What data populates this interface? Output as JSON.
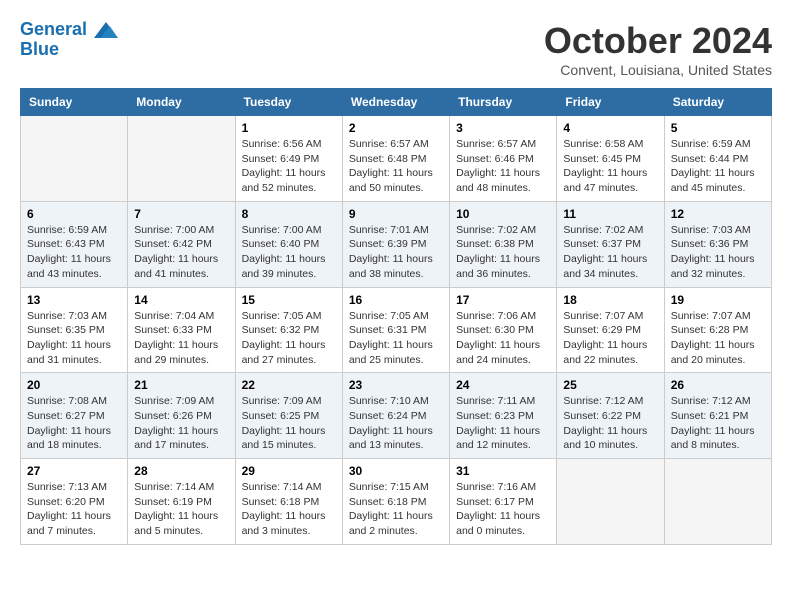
{
  "logo": {
    "line1": "General",
    "line2": "Blue"
  },
  "title": "October 2024",
  "location": "Convent, Louisiana, United States",
  "days_of_week": [
    "Sunday",
    "Monday",
    "Tuesday",
    "Wednesday",
    "Thursday",
    "Friday",
    "Saturday"
  ],
  "weeks": [
    [
      {
        "day": "",
        "info": ""
      },
      {
        "day": "",
        "info": ""
      },
      {
        "day": "1",
        "info": "Sunrise: 6:56 AM\nSunset: 6:49 PM\nDaylight: 11 hours and 52 minutes."
      },
      {
        "day": "2",
        "info": "Sunrise: 6:57 AM\nSunset: 6:48 PM\nDaylight: 11 hours and 50 minutes."
      },
      {
        "day": "3",
        "info": "Sunrise: 6:57 AM\nSunset: 6:46 PM\nDaylight: 11 hours and 48 minutes."
      },
      {
        "day": "4",
        "info": "Sunrise: 6:58 AM\nSunset: 6:45 PM\nDaylight: 11 hours and 47 minutes."
      },
      {
        "day": "5",
        "info": "Sunrise: 6:59 AM\nSunset: 6:44 PM\nDaylight: 11 hours and 45 minutes."
      }
    ],
    [
      {
        "day": "6",
        "info": "Sunrise: 6:59 AM\nSunset: 6:43 PM\nDaylight: 11 hours and 43 minutes."
      },
      {
        "day": "7",
        "info": "Sunrise: 7:00 AM\nSunset: 6:42 PM\nDaylight: 11 hours and 41 minutes."
      },
      {
        "day": "8",
        "info": "Sunrise: 7:00 AM\nSunset: 6:40 PM\nDaylight: 11 hours and 39 minutes."
      },
      {
        "day": "9",
        "info": "Sunrise: 7:01 AM\nSunset: 6:39 PM\nDaylight: 11 hours and 38 minutes."
      },
      {
        "day": "10",
        "info": "Sunrise: 7:02 AM\nSunset: 6:38 PM\nDaylight: 11 hours and 36 minutes."
      },
      {
        "day": "11",
        "info": "Sunrise: 7:02 AM\nSunset: 6:37 PM\nDaylight: 11 hours and 34 minutes."
      },
      {
        "day": "12",
        "info": "Sunrise: 7:03 AM\nSunset: 6:36 PM\nDaylight: 11 hours and 32 minutes."
      }
    ],
    [
      {
        "day": "13",
        "info": "Sunrise: 7:03 AM\nSunset: 6:35 PM\nDaylight: 11 hours and 31 minutes."
      },
      {
        "day": "14",
        "info": "Sunrise: 7:04 AM\nSunset: 6:33 PM\nDaylight: 11 hours and 29 minutes."
      },
      {
        "day": "15",
        "info": "Sunrise: 7:05 AM\nSunset: 6:32 PM\nDaylight: 11 hours and 27 minutes."
      },
      {
        "day": "16",
        "info": "Sunrise: 7:05 AM\nSunset: 6:31 PM\nDaylight: 11 hours and 25 minutes."
      },
      {
        "day": "17",
        "info": "Sunrise: 7:06 AM\nSunset: 6:30 PM\nDaylight: 11 hours and 24 minutes."
      },
      {
        "day": "18",
        "info": "Sunrise: 7:07 AM\nSunset: 6:29 PM\nDaylight: 11 hours and 22 minutes."
      },
      {
        "day": "19",
        "info": "Sunrise: 7:07 AM\nSunset: 6:28 PM\nDaylight: 11 hours and 20 minutes."
      }
    ],
    [
      {
        "day": "20",
        "info": "Sunrise: 7:08 AM\nSunset: 6:27 PM\nDaylight: 11 hours and 18 minutes."
      },
      {
        "day": "21",
        "info": "Sunrise: 7:09 AM\nSunset: 6:26 PM\nDaylight: 11 hours and 17 minutes."
      },
      {
        "day": "22",
        "info": "Sunrise: 7:09 AM\nSunset: 6:25 PM\nDaylight: 11 hours and 15 minutes."
      },
      {
        "day": "23",
        "info": "Sunrise: 7:10 AM\nSunset: 6:24 PM\nDaylight: 11 hours and 13 minutes."
      },
      {
        "day": "24",
        "info": "Sunrise: 7:11 AM\nSunset: 6:23 PM\nDaylight: 11 hours and 12 minutes."
      },
      {
        "day": "25",
        "info": "Sunrise: 7:12 AM\nSunset: 6:22 PM\nDaylight: 11 hours and 10 minutes."
      },
      {
        "day": "26",
        "info": "Sunrise: 7:12 AM\nSunset: 6:21 PM\nDaylight: 11 hours and 8 minutes."
      }
    ],
    [
      {
        "day": "27",
        "info": "Sunrise: 7:13 AM\nSunset: 6:20 PM\nDaylight: 11 hours and 7 minutes."
      },
      {
        "day": "28",
        "info": "Sunrise: 7:14 AM\nSunset: 6:19 PM\nDaylight: 11 hours and 5 minutes."
      },
      {
        "day": "29",
        "info": "Sunrise: 7:14 AM\nSunset: 6:18 PM\nDaylight: 11 hours and 3 minutes."
      },
      {
        "day": "30",
        "info": "Sunrise: 7:15 AM\nSunset: 6:18 PM\nDaylight: 11 hours and 2 minutes."
      },
      {
        "day": "31",
        "info": "Sunrise: 7:16 AM\nSunset: 6:17 PM\nDaylight: 11 hours and 0 minutes."
      },
      {
        "day": "",
        "info": ""
      },
      {
        "day": "",
        "info": ""
      }
    ]
  ]
}
